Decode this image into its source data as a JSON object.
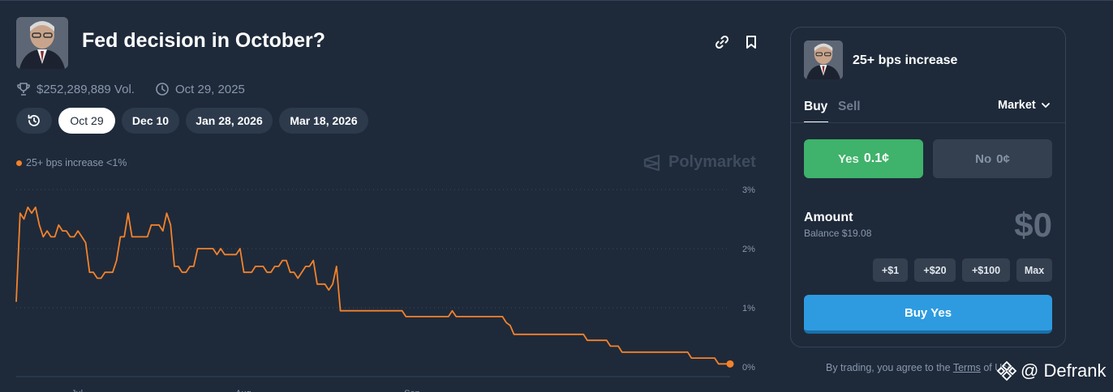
{
  "market": {
    "title": "Fed decision in October?",
    "volume": "$252,289,889 Vol.",
    "end_date": "Oct 29, 2025"
  },
  "date_pills": [
    "Oct 29",
    "Dec 10",
    "Jan 28, 2026",
    "Mar 18, 2026"
  ],
  "active_date_pill": "Oct 29",
  "legend": {
    "label": "25+ bps increase <1%",
    "color": "#f5822a"
  },
  "watermark": "Polymarket",
  "chart_data": {
    "type": "line",
    "y_tick_labels": [
      "3%",
      "2%",
      "1%",
      "0%"
    ],
    "ylim": [
      0,
      3
    ],
    "x_tick_labels": [
      "Jul",
      "Aug",
      "Sep"
    ],
    "grid": true,
    "series": [
      {
        "name": "25+ bps increase",
        "color": "#f5822a",
        "values": [
          1.1,
          2.6,
          2.5,
          2.7,
          2.6,
          2.7,
          2.4,
          2.2,
          2.3,
          2.2,
          2.2,
          2.4,
          2.3,
          2.3,
          2.2,
          2.2,
          2.3,
          2.2,
          2.1,
          1.6,
          1.6,
          1.5,
          1.5,
          1.6,
          1.6,
          1.6,
          1.8,
          2.2,
          2.2,
          2.6,
          2.2,
          2.2,
          2.2,
          2.2,
          2.2,
          2.4,
          2.4,
          2.4,
          2.3,
          2.6,
          2.4,
          1.7,
          1.7,
          1.6,
          1.6,
          1.7,
          1.7,
          2.0,
          2.0,
          2.0,
          2.0,
          2.0,
          1.9,
          2.0,
          1.9,
          1.9,
          1.9,
          1.9,
          2.0,
          1.6,
          1.6,
          1.6,
          1.7,
          1.7,
          1.7,
          1.6,
          1.6,
          1.7,
          1.7,
          1.8,
          1.8,
          1.6,
          1.6,
          1.5,
          1.6,
          1.7,
          1.7,
          1.8,
          1.4,
          1.4,
          1.4,
          1.3,
          1.4,
          1.7,
          0.95,
          0.95,
          0.95,
          0.95,
          0.95,
          0.95,
          0.95,
          0.95,
          0.95,
          0.95,
          0.95,
          0.95,
          0.95,
          0.95,
          0.95,
          0.95,
          0.95,
          0.85,
          0.85,
          0.85,
          0.85,
          0.85,
          0.85,
          0.85,
          0.85,
          0.85,
          0.85,
          0.85,
          0.85,
          0.95,
          0.85,
          0.85,
          0.85,
          0.85,
          0.85,
          0.85,
          0.85,
          0.85,
          0.85,
          0.85,
          0.85,
          0.85,
          0.85,
          0.75,
          0.7,
          0.55,
          0.55,
          0.55,
          0.55,
          0.55,
          0.55,
          0.55,
          0.55,
          0.55,
          0.55,
          0.55,
          0.55,
          0.55,
          0.55,
          0.55,
          0.55,
          0.55,
          0.55,
          0.55,
          0.45,
          0.45,
          0.45,
          0.45,
          0.45,
          0.45,
          0.35,
          0.35,
          0.35,
          0.25,
          0.25,
          0.25,
          0.25,
          0.25,
          0.25,
          0.25,
          0.25,
          0.25,
          0.25,
          0.25,
          0.25,
          0.25,
          0.25,
          0.25,
          0.25,
          0.25,
          0.25,
          0.15,
          0.15,
          0.15,
          0.15,
          0.15,
          0.15,
          0.15,
          0.05,
          0.05,
          0.05,
          0.05
        ]
      }
    ],
    "last_value_label": "<1%"
  },
  "trade_panel": {
    "outcome_title": "25+ bps increase",
    "tab_buy": "Buy",
    "tab_sell": "Sell",
    "order_type": "Market",
    "yes_label": "Yes",
    "yes_price": "0.1¢",
    "no_label": "No",
    "no_price": "0¢",
    "amount_label": "Amount",
    "balance": "Balance $19.08",
    "amount_value": "$0",
    "quick_amounts": [
      "+$1",
      "+$20",
      "+$100",
      "Max"
    ],
    "buy_button": "Buy Yes",
    "colors": {
      "yes": "#3fb26b",
      "buy": "#2e9be0",
      "no": "#34404f"
    }
  },
  "footer": {
    "terms_prefix": "By trading, you agree to the",
    "terms_link": "Terms",
    "terms_suffix": "of Use"
  },
  "watermark_user": "@ Defrank"
}
